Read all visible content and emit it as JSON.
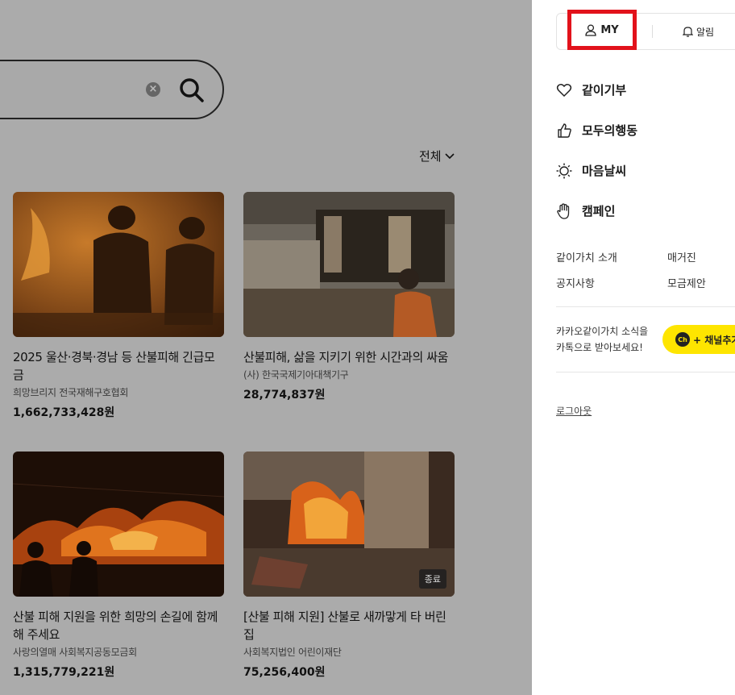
{
  "search": {
    "clear_glyph": "×"
  },
  "filter": {
    "label": "전체"
  },
  "campaigns": [
    {
      "title": "2025 울산·경북·경남 등 산불피해 긴급모금",
      "org": "희망브리지 전국재해구호협회",
      "amount": "1,662,733,428원"
    },
    {
      "title": "산불피해, 삶을 지키기 위한 시간과의 싸움",
      "org": "(사) 한국국제기아대책기구",
      "amount": "28,774,837원"
    },
    {
      "title": "산불 피해 지원을 위한 희망의 손길에 함께해 주세요",
      "org": "사랑의열매 사회복지공동모금회",
      "amount": "1,315,779,221원"
    },
    {
      "title": "[산불 피해 지원] 산불로 새까맣게 타 버린 집",
      "org": "사회복지법인 어린이재단",
      "amount": "75,256,400원",
      "badge": "종료"
    }
  ],
  "drawer": {
    "my_label": "MY",
    "alarm_label": "알림",
    "menu": [
      {
        "label": "같이기부",
        "icon": "heart-icon"
      },
      {
        "label": "모두의행동",
        "icon": "thumbs-up-icon"
      },
      {
        "label": "마음날씨",
        "icon": "sun-icon"
      },
      {
        "label": "캠페인",
        "icon": "hand-icon"
      }
    ],
    "links": [
      "같이가치 소개",
      "매거진",
      "공지사항",
      "모금제안"
    ],
    "promo_line1": "카카오같이가치 소식을",
    "promo_line2": "카톡으로 받아보세요!",
    "channel_icon_text": "Ch",
    "channel_label": "+ 채널추가",
    "logout": "로그아웃"
  },
  "colors": {
    "overlay": "#ababab",
    "kakao_yellow": "#fee500",
    "highlight_red": "#e2121b"
  }
}
